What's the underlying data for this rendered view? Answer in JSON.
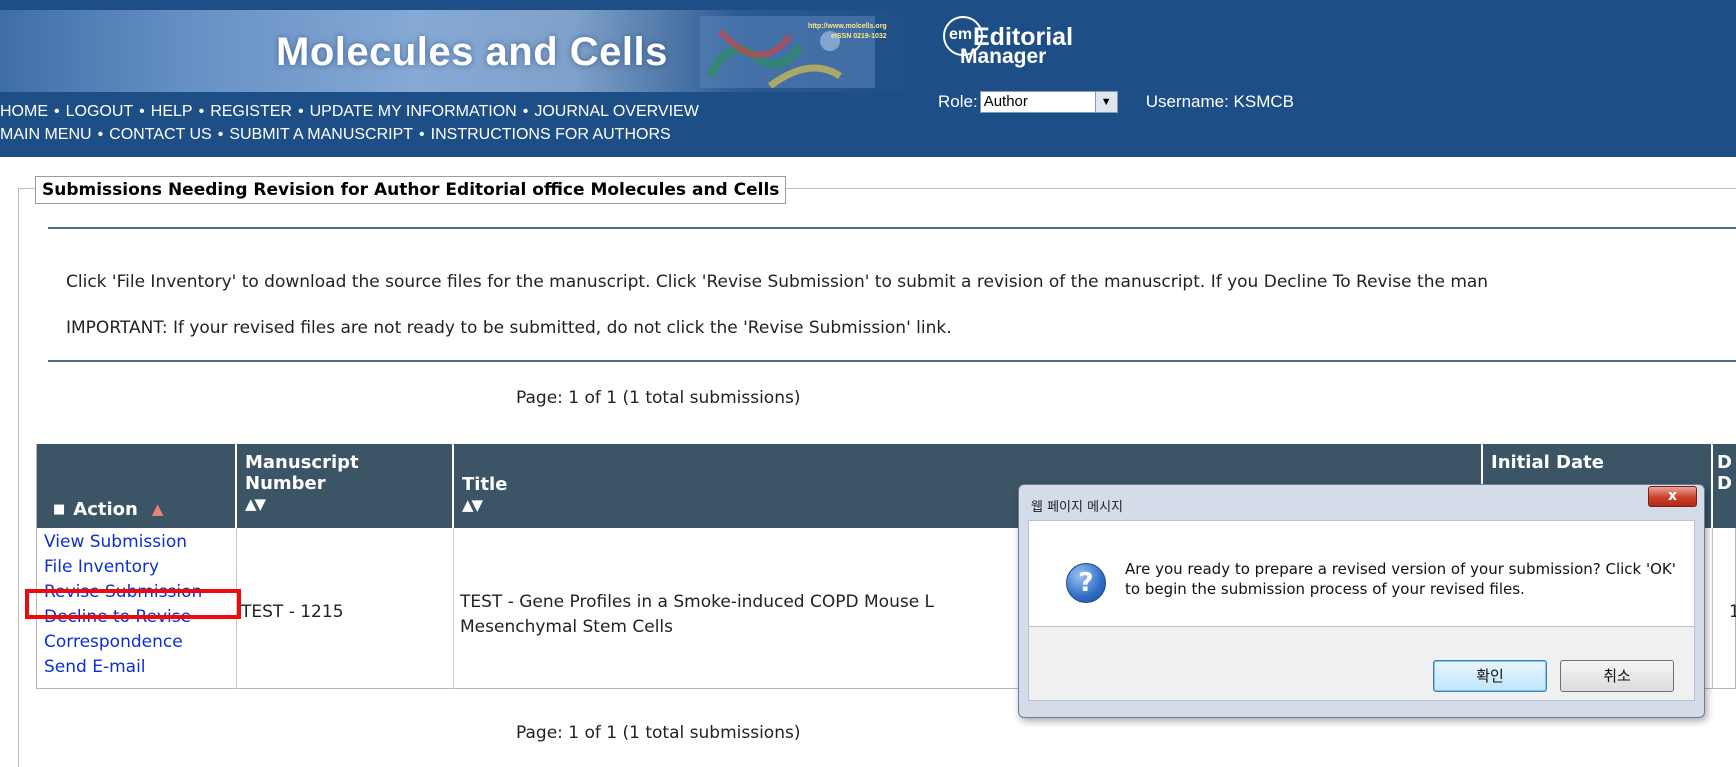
{
  "header": {
    "journal_title": "Molecules and Cells",
    "journal_url": "http://www.molcells.org",
    "journal_issn": "eISSN 0219-1032",
    "em_logo_prefix": "em",
    "em_logo_line1": "Editorial",
    "em_logo_line2": "Manager",
    "nav_row1": [
      "HOME",
      "LOGOUT",
      "HELP",
      "REGISTER",
      "UPDATE MY INFORMATION",
      "JOURNAL OVERVIEW"
    ],
    "nav_row2": [
      "MAIN MENU",
      "CONTACT US",
      "SUBMIT A MANUSCRIPT",
      "INSTRUCTIONS FOR AUTHORS"
    ],
    "nav_separator": "•",
    "role_label": "Role:",
    "role_value": "Author",
    "username_label": "Username: KSMCB"
  },
  "main": {
    "section_title": "Submissions Needing Revision for Author Editorial office Molecules and Cells",
    "instructions": "Click 'File Inventory' to download the source files for the manuscript. Click 'Revise Submission' to submit a revision of the manuscript. If you Decline To Revise the man",
    "important": "IMPORTANT: If your revised files are not ready to be submitted, do not click the 'Revise Submission' link.",
    "pager_top": "Page: 1 of 1 (1 total submissions)",
    "pager_bottom": "Page: 1 of 1 (1 total submissions)"
  },
  "table": {
    "columns": {
      "action": "Action",
      "manuscript_number_line1": "Manuscript",
      "manuscript_number_line2": "Number",
      "title": "Title",
      "initial_date": "Initial Date",
      "d_line1": "D",
      "d_line2": "D"
    },
    "sort_glyph": "▲▼",
    "action_sort_glyph": "▲",
    "collapse_glyph": "■",
    "rows": [
      {
        "actions": [
          "View Submission",
          "File Inventory",
          "Revise Submission",
          "Decline to Revise",
          "Correspondence",
          "Send E-mail"
        ],
        "manuscript_number": "TEST - 1215",
        "title_line1": "TEST - Gene Profiles in a Smoke-induced COPD Mouse L",
        "title_line2": "Mesenchymal Stem Cells",
        "d_value": "1"
      }
    ]
  },
  "dialog": {
    "title": "웹 페이지 메시지",
    "close_label": "x",
    "icon_glyph": "?",
    "message": "Are you ready to prepare a revised version of your submission?  Click 'OK' to begin the submission process of your revised files.",
    "ok_label": "확인",
    "cancel_label": "취소"
  },
  "colors": {
    "header_bg": "#1d4e86",
    "table_header_bg": "#3c5566",
    "link": "#0b2fd1",
    "highlight": "#ee0a0a"
  }
}
